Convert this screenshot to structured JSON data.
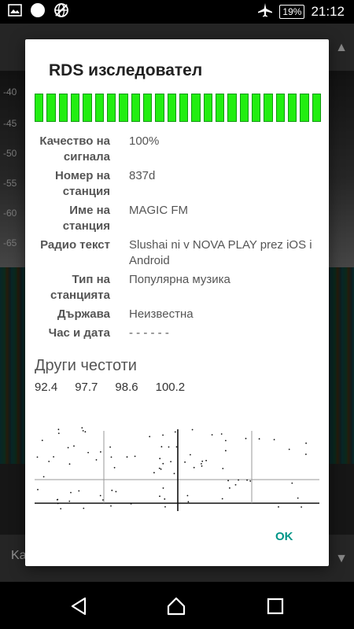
{
  "status_bar": {
    "time": "21:12",
    "battery": "19%",
    "icons": [
      "image-icon",
      "circle-icon",
      "globe-off-icon",
      "airplane-icon",
      "battery-icon"
    ]
  },
  "background": {
    "scale_labels": [
      "-40",
      "-45",
      "-50",
      "-55",
      "-60",
      "-65"
    ],
    "bottom_label": "Ka"
  },
  "dialog": {
    "title": "RDS изследовател",
    "signal_segments": 24,
    "signal_color": "#22ee11",
    "rows": [
      {
        "label": "Качество на сигнала",
        "value": "100%"
      },
      {
        "label": "Номер на станция",
        "value": "837d"
      },
      {
        "label": "Име на станция",
        "value": "MAGIC FM"
      },
      {
        "label": "Радио текст",
        "value": "Slushai ni v NOVA PLAY prez iOS i Android"
      },
      {
        "label": "Тип на станцията",
        "value": "Популярна музика"
      },
      {
        "label": "Държава",
        "value": "Неизвестна"
      },
      {
        "label": "Час и дата",
        "value": "- - - - - -"
      }
    ],
    "other_freqs_title": "Други честоти",
    "other_freqs": [
      "92.4",
      "97.7",
      "98.6",
      "100.2"
    ],
    "ok_label": "OK"
  },
  "accent_color": "#009688"
}
